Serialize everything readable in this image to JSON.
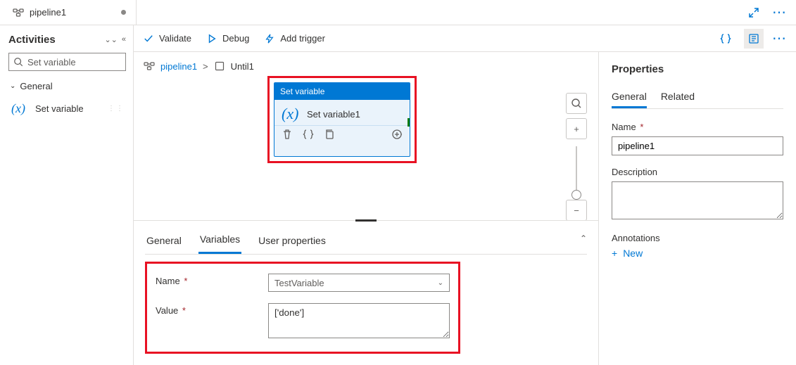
{
  "tab": {
    "title": "pipeline1"
  },
  "sidebar": {
    "heading": "Activities",
    "search_placeholder": "Set variable",
    "category": "General",
    "items": [
      {
        "label": "Set variable"
      }
    ]
  },
  "toolbar": {
    "validate": "Validate",
    "debug": "Debug",
    "add_trigger": "Add trigger"
  },
  "breadcrumb": {
    "root": "pipeline1",
    "child": "Until1"
  },
  "activity": {
    "type_label": "Set variable",
    "name": "Set variable1"
  },
  "bottom_tabs": {
    "general": "General",
    "variables": "Variables",
    "user_props": "User properties"
  },
  "form": {
    "name_label": "Name",
    "name_value": "TestVariable",
    "value_label": "Value",
    "value_value": "['done']"
  },
  "props": {
    "heading": "Properties",
    "tab_general": "General",
    "tab_related": "Related",
    "name_label": "Name",
    "name_value": "pipeline1",
    "desc_label": "Description",
    "desc_value": "",
    "annot_label": "Annotations",
    "new_label": "New"
  }
}
